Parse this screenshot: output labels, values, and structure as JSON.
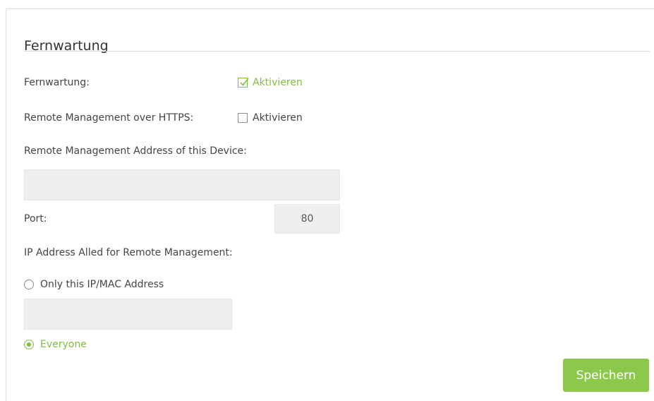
{
  "section": {
    "title": "Fernwartung"
  },
  "form": {
    "remote_mgmt": {
      "label": "Fernwartung:",
      "checkbox_label": "Aktivieren",
      "checked": true
    },
    "remote_https": {
      "label": "Remote Management over HTTPS:",
      "checkbox_label": "Aktivieren",
      "checked": false
    },
    "device_address": {
      "label": "Remote Management Address of this Device:",
      "value": ""
    },
    "port": {
      "label": "Port:",
      "value": "80"
    },
    "allowed_ip": {
      "label": "IP Address Alled for Remote Management:",
      "option_specific": {
        "label": "Only this IP/MAC Address",
        "selected": false
      },
      "specific_value": "",
      "option_everyone": {
        "label": "Everyone",
        "selected": true
      }
    }
  },
  "actions": {
    "save_label": "Speichern"
  },
  "colors": {
    "accent": "#8cc84b",
    "accent_text": "#7fbf3b",
    "input_bg": "#efefef"
  }
}
